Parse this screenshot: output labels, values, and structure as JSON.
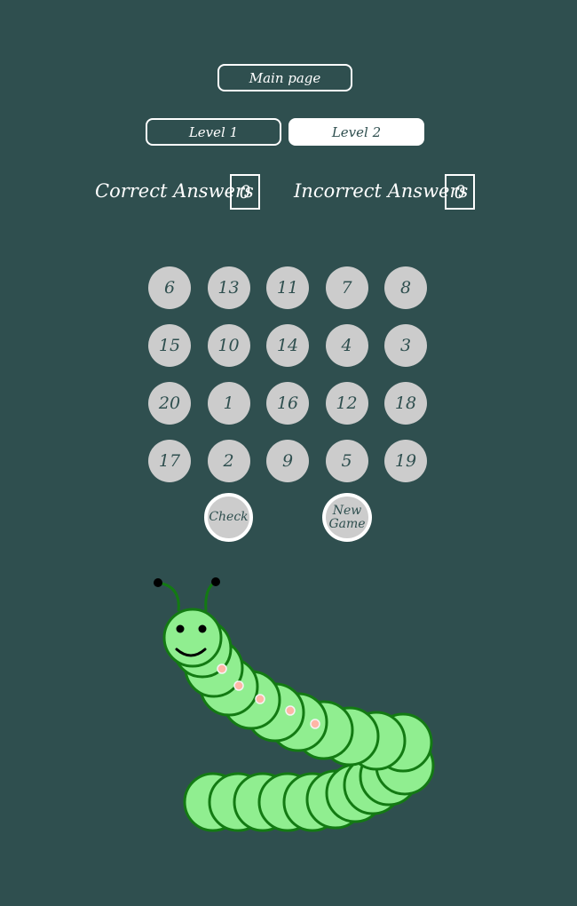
{
  "nav": {
    "main_page": "Main page",
    "level1": "Level 1",
    "level2": "Level 2",
    "active_level": "Level 2"
  },
  "score": {
    "correct_label": "Correct Answers",
    "correct_value": "0",
    "incorrect_label": "Incorrect Answers",
    "incorrect_value": "0"
  },
  "grid": {
    "numbers": [
      "6",
      "13",
      "11",
      "7",
      "8",
      "15",
      "10",
      "14",
      "4",
      "3",
      "20",
      "1",
      "16",
      "12",
      "18",
      "17",
      "2",
      "9",
      "5",
      "19"
    ]
  },
  "actions": {
    "check": "Check",
    "new_game": "New Game"
  },
  "colors": {
    "background": "#2f4f4f",
    "number_circle": "#cccccc",
    "worm_body": "#90ee90",
    "worm_outline": "#137a13",
    "worm_spot": "#ffb6a6"
  }
}
